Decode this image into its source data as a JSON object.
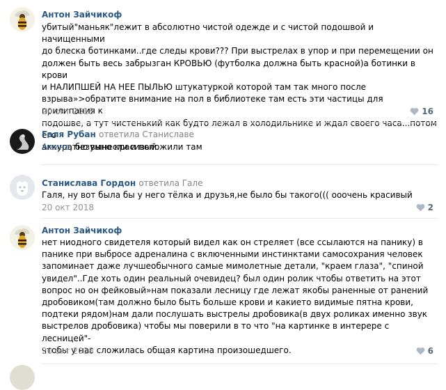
{
  "comments": [
    {
      "author": "Антон Зайчикоф",
      "reply_to": "",
      "mention": "",
      "text": "убитый\"маньяк\"лежит в абсолютно чистой одежде и с чистой подошвой и начищенными\nдо блеска ботинками..где следы крови??? При выстрелах в упор и при перемещении он\nдолжен быть весь забрызган КРОВЬЮ (футболка должна быть красной)а ботинки в крови\nи НАЛИПШЕЙ НА НЕЕ ПЫЛЬЮ штукатуркой которой там так много после\nвзрыва»>обратите внимание на пол в библиотеке там есть эти частицы для прилипания к\nподошве, а тут чистенький как будто лежал в холодильнике и ждал своего часа...потом его\nаккуратно вынесли и положили там",
      "date": "20 окт 2018",
      "likes": "16",
      "avatar_icon": "wasp-avatar-icon"
    },
    {
      "author": "Галя Рубан",
      "reply_to": "ответила Станиславе",
      "mention": "Амина",
      "text": ", безумно красивый.",
      "date": "20 окт 2018",
      "likes": "",
      "avatar_icon": "swan-avatar-icon"
    },
    {
      "author": "Станислава Гордон",
      "reply_to": "ответила Гале",
      "mention": "",
      "text": "Галя, ну вот была бы у него тёлка и друзья,не было бы такого((( ооочень красивый",
      "date": "20 окт 2018",
      "likes": "2",
      "avatar_icon": "default-dog-avatar-icon"
    },
    {
      "author": "Антон Зайчикоф",
      "reply_to": "",
      "mention": "",
      "text": "нет ниодного свидетеля который видел как он стреляет (все ссылаются на панику) в\nпанике при выбросе адреналина с включенными инстинктами самосохрания человек\nзапоминает даже лучшеобычного самые мимолетные детали, \"краем глаза\", \"спиной\nувидел\"..Где хоть один реальный очевидец? был один ролик чтобы ответить на этот\nвопрос но он фейковый»нам показали лесницу где лежат якобы раненные от ранений\nдробовиком(там должно было быть больше крови и какието видимые пятна крови,\nподтеки рядом)нам дали послушать выстрелы дробовика(в двух роликах именно звук\nвыстрелов дробовика) чтобы мы поверили в то что \"на картинке в интерере с лесницей\"-\nчтобы у нас сложилась общая картина произошедшего.",
      "date": "20 окт 2018",
      "likes": "6",
      "avatar_icon": "wasp-avatar-icon"
    }
  ],
  "colors": {
    "link": "#2a5885",
    "muted": "#939393",
    "like_icon": "#aeb7c2",
    "separator": "#e7e8ec"
  }
}
